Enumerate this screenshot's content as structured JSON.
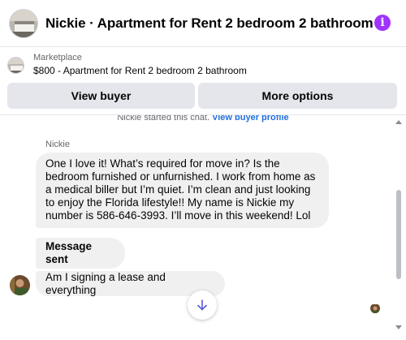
{
  "header": {
    "title": "Nickie · Apartment for Rent 2 bedroom 2 bathroom",
    "info_icon": "i"
  },
  "listing": {
    "source": "Marketplace",
    "title": "$800 - Apartment for Rent 2 bedroom 2 bathroom"
  },
  "actions": {
    "view_buyer": "View buyer",
    "more_options": "More options"
  },
  "chat": {
    "system_note": "Nickie started this chat.",
    "system_link": "View buyer profile",
    "sender_name": "Nickie",
    "messages": [
      "One I love it! What’s required for move in? Is the bedroom furnished or unfurnished. I work from home as a medical biller but I’m quiet. I’m clean and just looking to enjoy the Florida lifestyle!! My name is Nickie my number is 586-646-3993. I’ll move in this weekend! Lol",
      "Message sent",
      "Am I signing a lease and everything"
    ]
  },
  "colors": {
    "accent": "#a033ff",
    "link": "#216fdb",
    "bubble": "#f0f0f0",
    "button": "#e4e6eb"
  },
  "icons": [
    "apartment-thumbnail",
    "info-icon",
    "user-avatar",
    "arrow-down-icon",
    "seen-avatar"
  ]
}
